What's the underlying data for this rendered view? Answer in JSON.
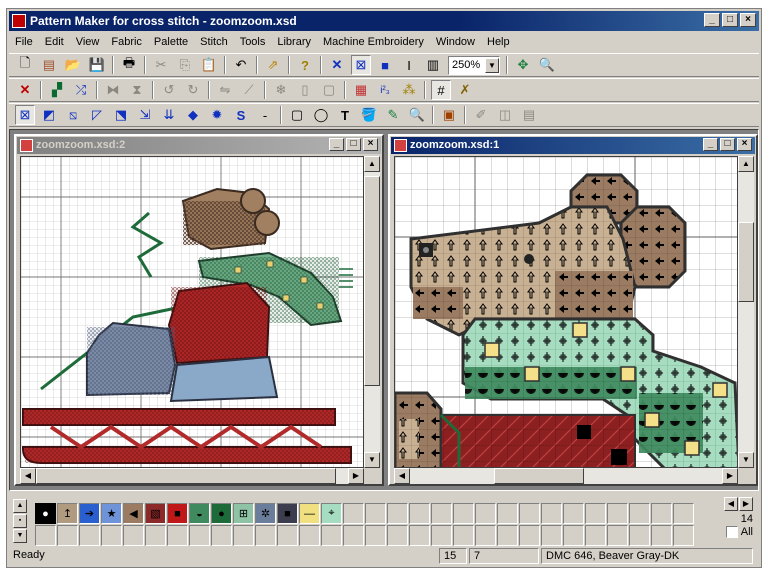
{
  "window": {
    "title": "Pattern Maker for cross stitch - zoomzoom.xsd",
    "min_label": "_",
    "max_label": "□",
    "close_label": "×"
  },
  "menu": [
    "File",
    "Edit",
    "View",
    "Fabric",
    "Palette",
    "Stitch",
    "Tools",
    "Library",
    "Machine Embroidery",
    "Window",
    "Help"
  ],
  "toolbar": {
    "zoom_value": "250%",
    "row1_icons": [
      "new-icon",
      "copy-file-icon",
      "open-icon",
      "save-icon",
      "print-icon",
      "cut-icon",
      "copy-icon",
      "paste-icon",
      "undo-icon",
      "import-icon",
      "help-icon",
      "cross-icon",
      "select-stitch-icon",
      "fill-square-icon",
      "text-cursor-icon",
      "page-icon",
      "fit-window-icon",
      "zoom-find-icon"
    ],
    "row2_icons": [
      "delete-icon",
      "color-replace-icon",
      "swap-icon",
      "mirror-h-icon",
      "mirror-v-icon",
      "rotate-left-icon",
      "rotate-right-icon",
      "flip-icon",
      "backstitch-icon",
      "snowflake-icon",
      "column-icon",
      "frame-icon",
      "palette-grid-icon",
      "numbers-icon",
      "symbol-icon",
      "grid-icon",
      "tools-icon"
    ],
    "row3_icons": [
      "full-stitch-icon",
      "half-stitch-icon",
      "diag-stitch-icon",
      "quarter-stitch-icon",
      "three-quarter-stitch-icon",
      "fractional-icon",
      "bead-icon",
      "french-knot-icon",
      "s-curve-icon",
      "dash-icon",
      "rectangle-icon",
      "circle-icon",
      "text-icon",
      "fill-icon",
      "eyedropper-icon",
      "magnify-icon",
      "brush-icon",
      "pencil-icon",
      "columns-icon",
      "pages-icon"
    ]
  },
  "child_windows": [
    {
      "title": "zoomzoom.xsd:2",
      "state": "inactive"
    },
    {
      "title": "zoomzoom.xsd:1",
      "state": "active"
    }
  ],
  "palette": {
    "count": "14",
    "all_label": "All",
    "swatches": [
      {
        "bg": "#000000",
        "symbol": "●",
        "fg": "#ffffff"
      },
      {
        "bg": "#b09a80",
        "symbol": "↥",
        "fg": "#000000"
      },
      {
        "bg": "#2a5fd0",
        "symbol": "➔",
        "fg": "#000000"
      },
      {
        "bg": "#6f93d8",
        "symbol": "★",
        "fg": "#000000"
      },
      {
        "bg": "#9b7c62",
        "symbol": "◀",
        "fg": "#000000"
      },
      {
        "bg": "#8c2a2a",
        "symbol": "▧",
        "fg": "#000000"
      },
      {
        "bg": "#c01818",
        "symbol": "■",
        "fg": "#000000"
      },
      {
        "bg": "#3f8a5e",
        "symbol": "◒",
        "fg": "#000000"
      },
      {
        "bg": "#1e6b3a",
        "symbol": "●",
        "fg": "#000000"
      },
      {
        "bg": "#8ec3a6",
        "symbol": "⊞",
        "fg": "#000000"
      },
      {
        "bg": "#6a7d9a",
        "symbol": "✲",
        "fg": "#000000"
      },
      {
        "bg": "#3d3d50",
        "symbol": "■",
        "fg": "#000000"
      },
      {
        "bg": "#f0e080",
        "symbol": "—",
        "fg": "#000000"
      },
      {
        "bg": "#a6dcc0",
        "symbol": "⌖",
        "fg": "#000000"
      }
    ]
  },
  "status": {
    "text": "Ready",
    "col": "15",
    "row": "7",
    "color_info": "DMC 646, Beaver Gray-DK"
  }
}
